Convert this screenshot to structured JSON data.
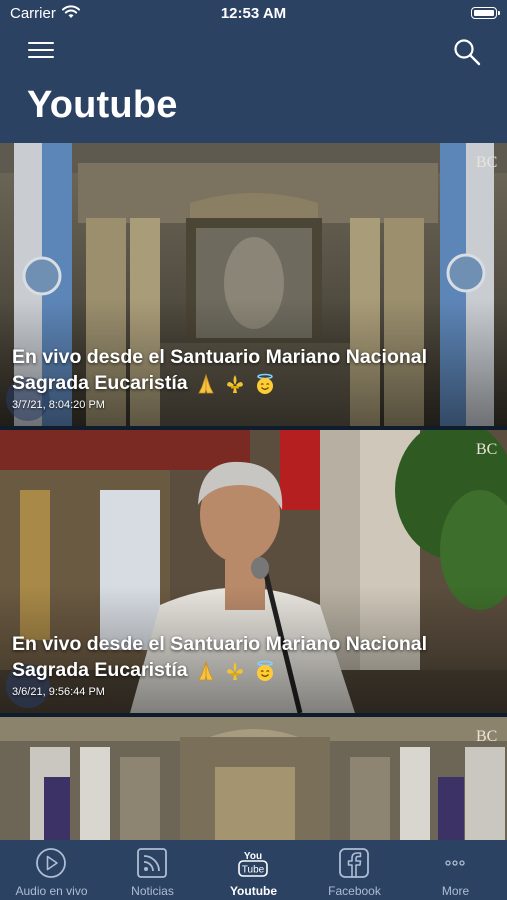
{
  "status_bar": {
    "carrier": "Carrier",
    "time": "12:53 AM"
  },
  "header": {
    "title": "Youtube"
  },
  "videos": [
    {
      "title": "En vivo desde el Santuario Mariano Nacional Sagrada Eucaristía",
      "emojis": [
        "pray",
        "fleur-de-lis",
        "smiling-face-with-halo"
      ],
      "date": "3/7/21, 8:04:20 PM",
      "watermark": "BC"
    },
    {
      "title": "En vivo desde el Santuario Mariano Nacional Sagrada Eucaristía",
      "emojis": [
        "pray",
        "fleur-de-lis",
        "smiling-face-with-halo"
      ],
      "date": "3/6/21, 9:56:44 PM",
      "watermark": "BC"
    },
    {
      "title": "",
      "date": "",
      "watermark": "BC"
    }
  ],
  "tabbar": {
    "tabs": [
      {
        "label": "Audio en vivo",
        "icon": "play-circle-icon",
        "active": false
      },
      {
        "label": "Noticias",
        "icon": "rss-icon",
        "active": false
      },
      {
        "label": "Youtube",
        "icon": "youtube-icon",
        "active": true
      },
      {
        "label": "Facebook",
        "icon": "facebook-icon",
        "active": false
      },
      {
        "label": "More",
        "icon": "more-icon",
        "active": false
      }
    ]
  },
  "colors": {
    "header": "#2c4263",
    "tab_inactive": "#aebdd2",
    "tab_active": "#ffffff"
  }
}
